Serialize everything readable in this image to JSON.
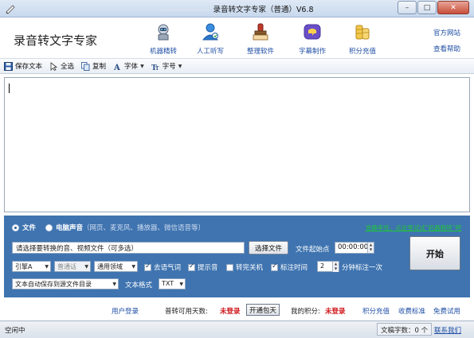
{
  "window": {
    "title": "录音转文字专家（普通）V6.8",
    "buttons": {
      "minimize": "–",
      "maximize": "□",
      "close": "✕"
    }
  },
  "header": {
    "brand": "录音转文字专家",
    "tools": [
      {
        "label": "机器精转",
        "icon": "robot-icon"
      },
      {
        "label": "人工听写",
        "icon": "person-icon"
      },
      {
        "label": "整理软件",
        "icon": "stamp-icon"
      },
      {
        "label": "字幕制作",
        "icon": "subtitle-icon"
      },
      {
        "label": "积分充值",
        "icon": "coins-icon"
      }
    ],
    "links": {
      "website": "官方网站",
      "help": "查看帮助"
    }
  },
  "toolbar": {
    "save": "保存文本",
    "select_all": "全选",
    "copy": "复制",
    "font": "字体",
    "font_size": "字号"
  },
  "source": {
    "file_label": "文件",
    "computer_audio_label": "电脑声音",
    "computer_audio_hint": "（网页、麦克风、播放器、微信语音等）",
    "selected": "file",
    "promo_link": "准确率低，点这里试试“机器精转”吧"
  },
  "controls": {
    "file_placeholder": "请选择要转换的音、视频文件（可多选）",
    "select_file_button": "选择文件",
    "start_point_label": "文件起始点",
    "start_point_value": "00:00:00",
    "start_button": "开始",
    "engine_select": "引擎A",
    "language_select": "普通话",
    "domain_select": "通用领域",
    "remove_filler": {
      "label": "去语气词",
      "checked": true
    },
    "beep": {
      "label": "提示音",
      "checked": true
    },
    "shutdown": {
      "label": "转完关机",
      "checked": false
    },
    "mark_time": {
      "label": "标注时间",
      "checked": true
    },
    "interval_value": "2",
    "interval_suffix": "分钟标注一次",
    "save_mode_select": "文本自动保存到源文件目录",
    "format_label": "文本格式",
    "format_select": "TXT"
  },
  "account": {
    "login": "用户登录",
    "days_label": "普转可用天数:",
    "days_value": "未登录",
    "open_package": "开通包天",
    "points_label": "我的积分:",
    "points_value": "未登录",
    "recharge": "积分充值",
    "pricing": "收费标准",
    "free_trial": "免费试用"
  },
  "status": {
    "left": "空闲中",
    "char_count": "文稿字数：0 个",
    "contact": "联系我们"
  }
}
